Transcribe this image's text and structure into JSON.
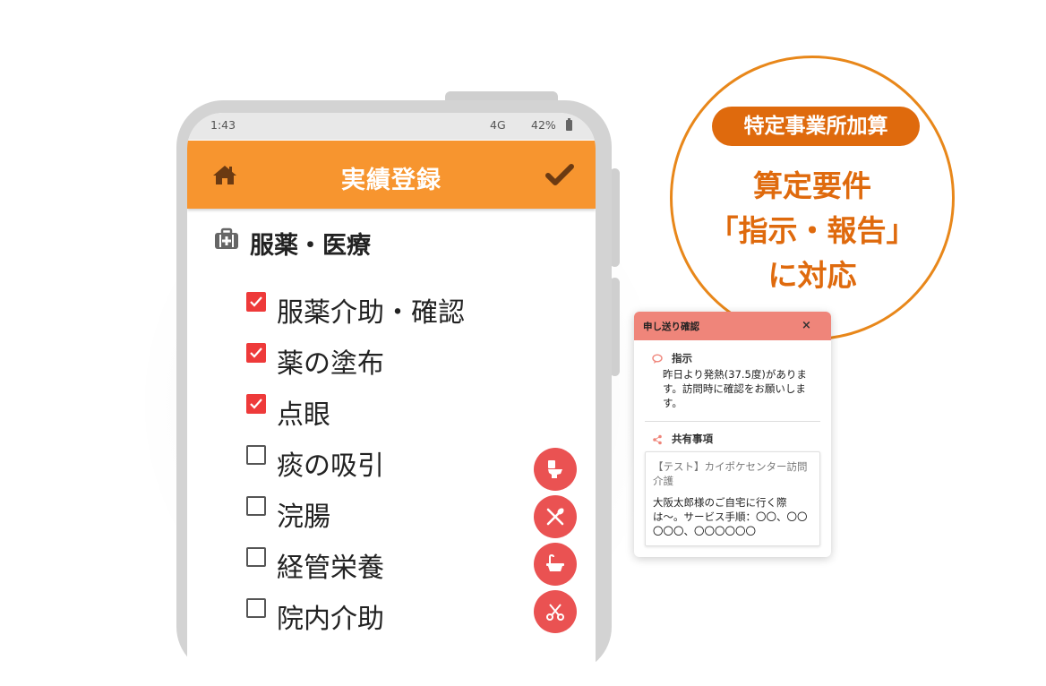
{
  "status_bar": {
    "time": "1:43",
    "network": "4G",
    "battery": "42%"
  },
  "app_bar": {
    "title": "実績登録"
  },
  "section": {
    "title": "服薬・医療"
  },
  "checklist": [
    {
      "label": "服薬介助・確認",
      "checked": true
    },
    {
      "label": "薬の塗布",
      "checked": true
    },
    {
      "label": "点眼",
      "checked": true
    },
    {
      "label": "痰の吸引",
      "checked": false
    },
    {
      "label": "浣腸",
      "checked": false
    },
    {
      "label": "経管栄養",
      "checked": false
    },
    {
      "label": "院内介助",
      "checked": false
    }
  ],
  "fab_icons": [
    "toilet-icon",
    "meal-icon",
    "bath-icon",
    "scissors-icon"
  ],
  "badge": {
    "pill": "特定事業所加算",
    "lines": [
      "算定要件",
      "「指示・報告」",
      "に対応"
    ]
  },
  "message_card": {
    "header": "申し送り確認",
    "close": "×",
    "instruction_title": "指示",
    "instruction_body": "昨日より発熱(37.5度)があります。訪問時に確認をお願いします。",
    "shared_title": "共有事項",
    "shared_org": "【テスト】カイポケセンター訪問介護",
    "shared_body": "大阪太郎様のご自宅に行く際は〜。サービス手順：〇〇、〇〇〇〇〇、〇〇〇〇〇〇"
  },
  "colors": {
    "app_bar": "#f7952f",
    "badge_orange": "#df6a0d",
    "checkbox_red": "#ee3a3a",
    "fab_red": "#ea5252",
    "card_header": "#ef857a"
  }
}
